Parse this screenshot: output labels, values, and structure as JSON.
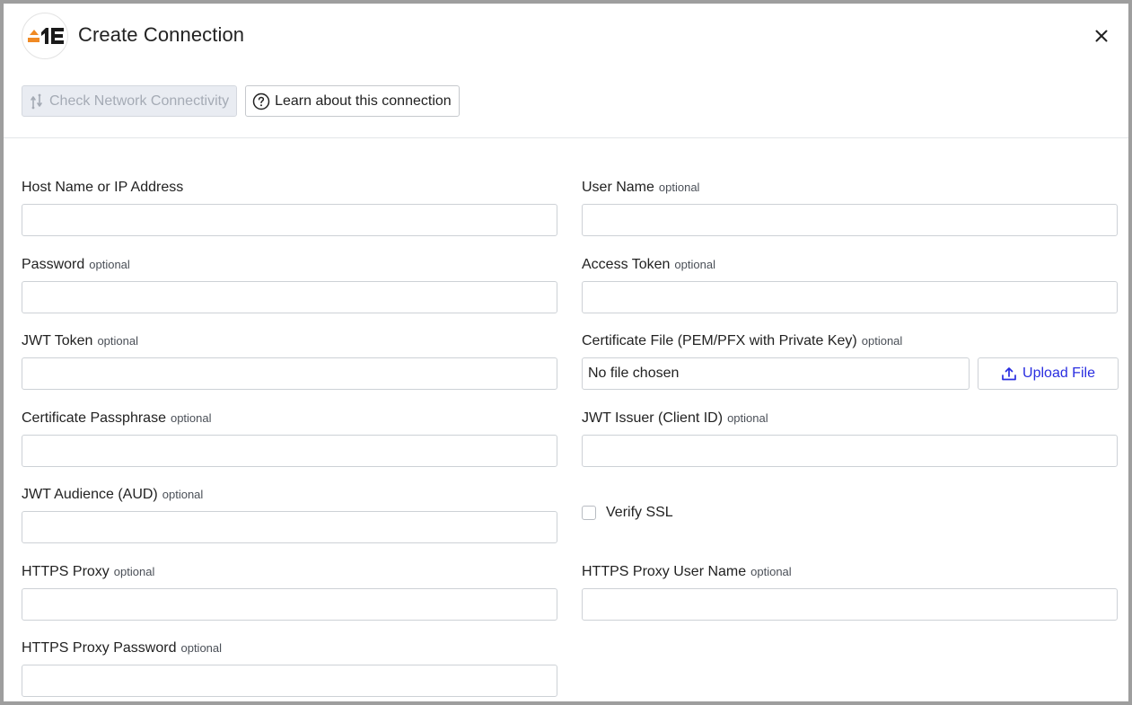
{
  "dialog": {
    "title": "Create Connection",
    "logo_icon": "1e-logo",
    "close_icon": "close-icon"
  },
  "toolbar": {
    "check_network_label": "Check Network Connectivity",
    "check_network_icon": "network-check-icon",
    "check_network_disabled": true,
    "learn_label": "Learn about this connection",
    "learn_icon": "help-circle-icon"
  },
  "form": {
    "optional_text": "optional",
    "host": {
      "label": "Host Name or IP Address",
      "value": ""
    },
    "user_name": {
      "label": "User Name",
      "value": ""
    },
    "password": {
      "label": "Password",
      "value": ""
    },
    "access_token": {
      "label": "Access Token",
      "value": ""
    },
    "jwt_token": {
      "label": "JWT Token",
      "value": ""
    },
    "certificate_file": {
      "label": "Certificate File (PEM/PFX with Private Key)",
      "file_text": "No file chosen",
      "upload_label": "Upload File",
      "upload_icon": "upload-icon"
    },
    "certificate_passphrase": {
      "label": "Certificate Passphrase",
      "value": ""
    },
    "jwt_issuer": {
      "label": "JWT Issuer (Client ID)",
      "value": ""
    },
    "jwt_audience": {
      "label": "JWT Audience (AUD)",
      "value": ""
    },
    "verify_ssl": {
      "label": "Verify SSL",
      "checked": false
    },
    "https_proxy": {
      "label": "HTTPS Proxy",
      "value": ""
    },
    "https_proxy_user": {
      "label": "HTTPS Proxy User Name",
      "value": ""
    },
    "https_proxy_password": {
      "label": "HTTPS Proxy Password",
      "value": ""
    }
  },
  "colors": {
    "accent": "#2a2ee0",
    "logo_orange": "#f08a24",
    "logo_dark": "#1a1a1a",
    "disabled_bg": "#e9ecf2",
    "disabled_text": "#a5abb5"
  }
}
